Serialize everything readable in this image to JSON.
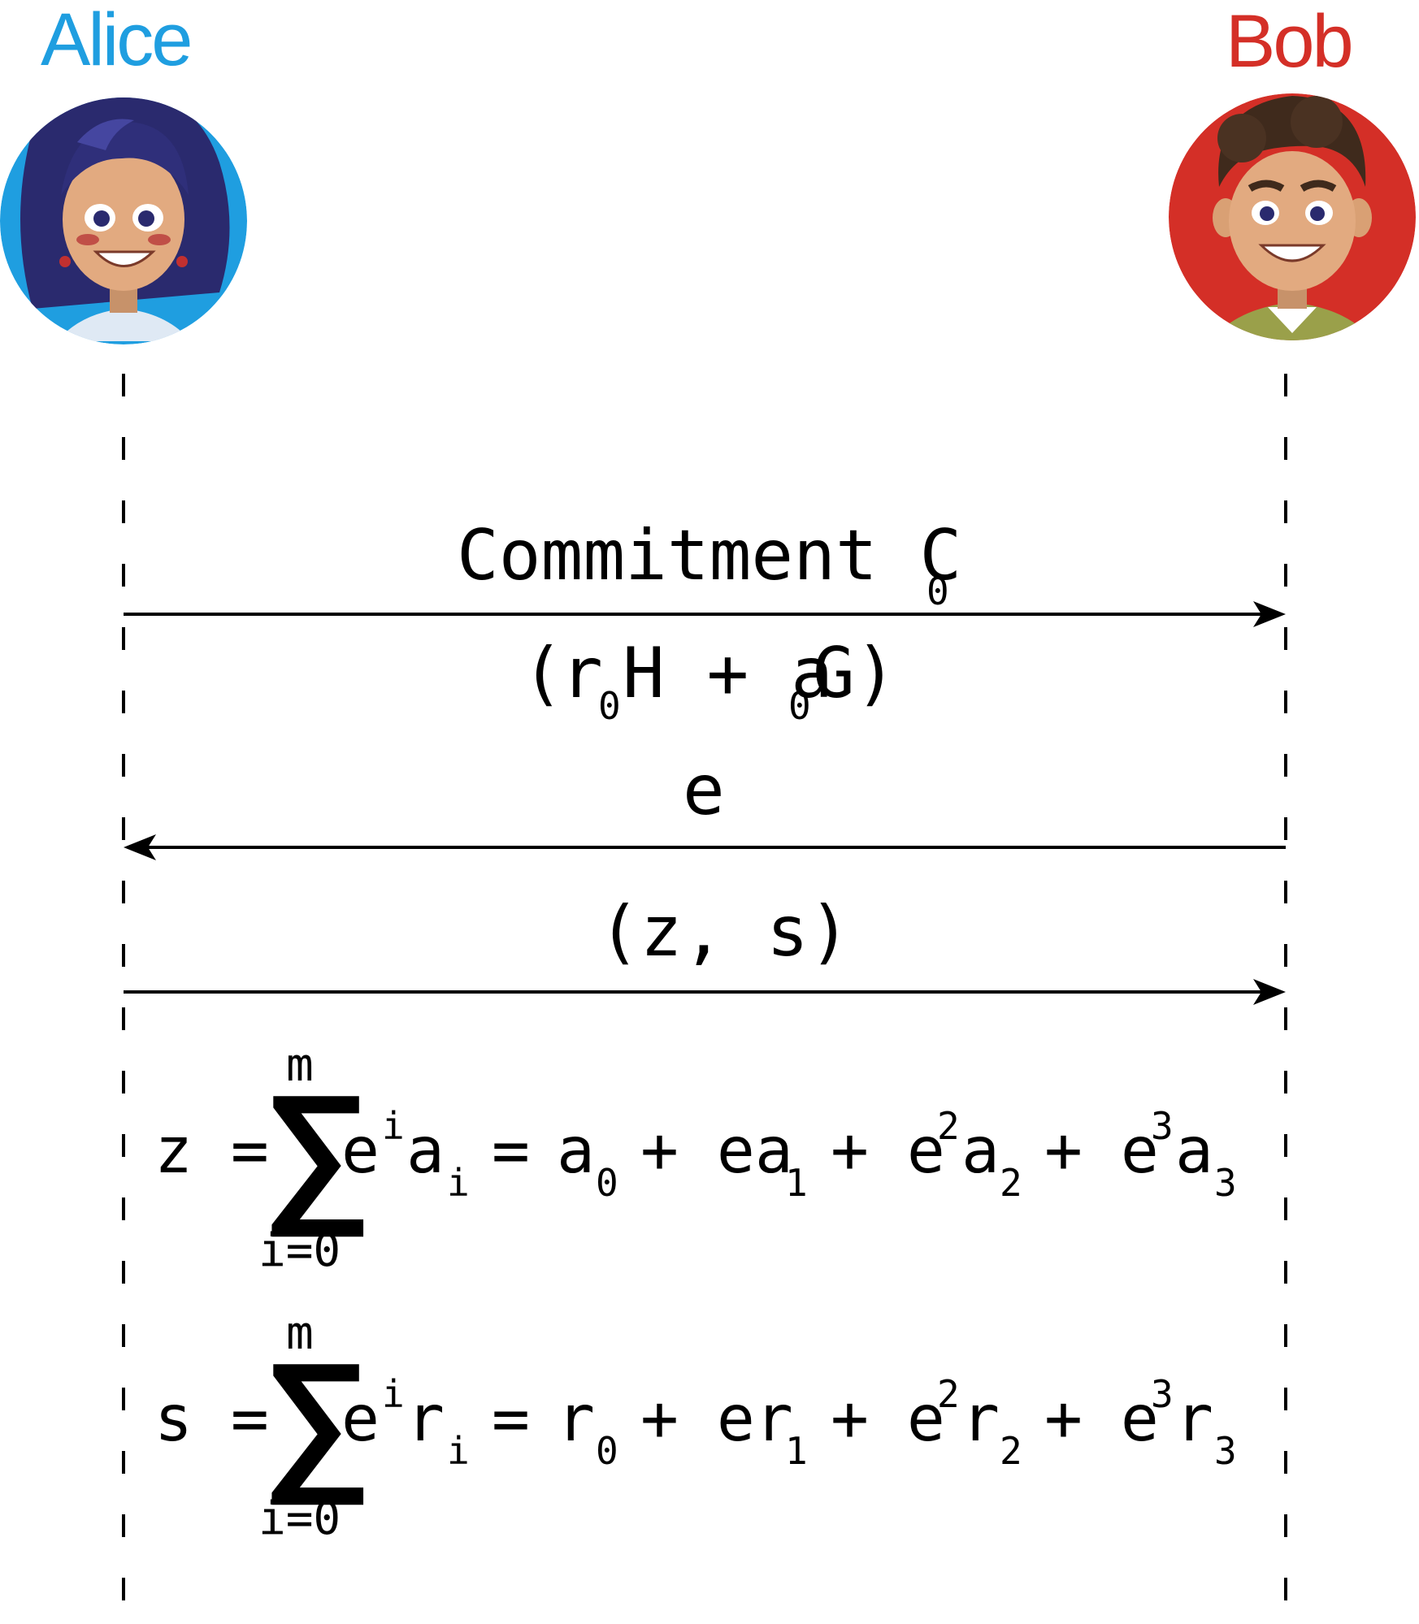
{
  "actors": {
    "alice": {
      "name": "Alice",
      "color": "#1f9ee0"
    },
    "bob": {
      "name": "Bob",
      "color": "#d42f27"
    }
  },
  "messages": {
    "commitment": {
      "label": "Commitment C",
      "sub": "0",
      "direction": "alice-to-bob"
    },
    "commitment_formula": {
      "open": "(",
      "r": "r",
      "r_sub": "0",
      "mid": "H + a",
      "a_sub": "0",
      "close": "G)"
    },
    "challenge": {
      "label": "e",
      "direction": "bob-to-alice"
    },
    "response": {
      "label": "(z, s)",
      "direction": "alice-to-bob"
    }
  },
  "equations": {
    "z": {
      "lhs": "z =",
      "sum_top": "m",
      "sum_bottom": "i=0",
      "term": "e",
      "term_sup": "i",
      "var": "a",
      "var_sub": "i",
      "eq": "=",
      "t0": "a",
      "t0_sub": "0",
      "t1": "+ ea",
      "t1_sub": "1",
      "t2a": "+ e",
      "t2_sup": "2",
      "t2b": "a",
      "t2_sub": "2",
      "t3a": "+ e",
      "t3_sup": "3",
      "t3b": "a",
      "t3_sub": "3"
    },
    "s": {
      "lhs": "s =",
      "sum_top": "m",
      "sum_bottom": "i=0",
      "term": "e",
      "term_sup": "i",
      "var": "r",
      "var_sub": "i",
      "eq": "=",
      "t0": "r",
      "t0_sub": "0",
      "t1": "+ er",
      "t1_sub": "1",
      "t2a": "+ e",
      "t2_sup": "2",
      "t2b": "r",
      "t2_sub": "2",
      "t3a": "+ e",
      "t3_sup": "3",
      "t3b": "r",
      "t3_sub": "3"
    },
    "sigma_symbol": "∑"
  }
}
